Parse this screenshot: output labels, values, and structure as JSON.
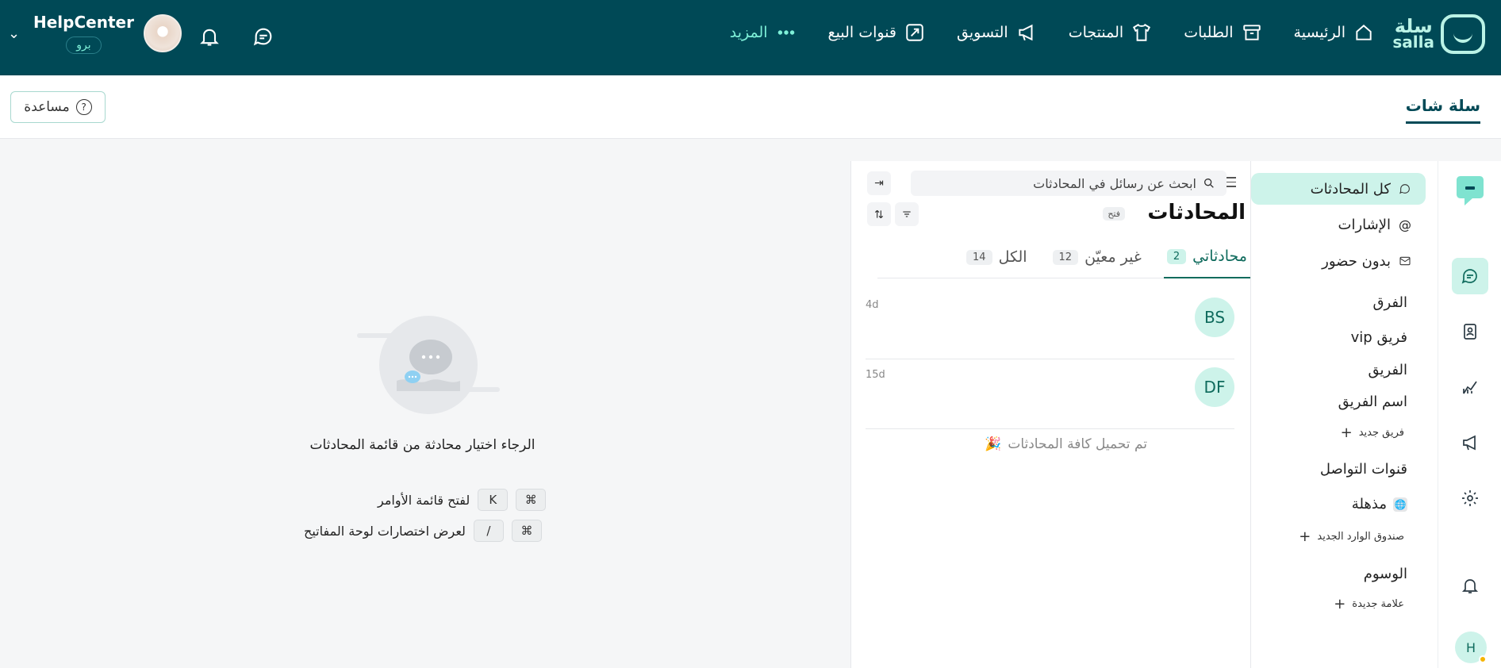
{
  "topnav": {
    "logo_text_ar": "سلة",
    "logo_text_en": "salla",
    "items": [
      {
        "label": "الرئيسية",
        "icon": "home-icon"
      },
      {
        "label": "الطلبات",
        "icon": "box-icon"
      },
      {
        "label": "المنتجات",
        "icon": "shirt-icon"
      },
      {
        "label": "التسويق",
        "icon": "megaphone-icon"
      },
      {
        "label": "قنوات البيع",
        "icon": "sales-channel-icon"
      },
      {
        "label": "المزيد",
        "icon": "more-dots-icon"
      }
    ],
    "account_name": "HelpCenter",
    "account_plan": "برو"
  },
  "pagehead": {
    "title": "سلة شات",
    "help_label": "مساعدة"
  },
  "sidebar": {
    "all_conversations": "كل المحادثات",
    "mentions": "الإشارات",
    "unattended": "بدون حضور",
    "teams_heading": "الفرق",
    "team_vip": "فريق vip",
    "team_generic": "الفريق",
    "team_name": "اسم الفريق",
    "new_team": "فريق جديد",
    "channels_heading": "قنوات التواصل",
    "channel_1": "مذهلة",
    "new_inbox": "صندوق الوارد الجديد",
    "labels_heading": "الوسوم",
    "new_label": "علامة جديدة"
  },
  "rail": {
    "user_initial": "H"
  },
  "conversations": {
    "search_placeholder": "ابحث عن رسائل في المحادثات",
    "title": "المحادثات",
    "status": "فتح",
    "tabs": [
      {
        "label": "محادثاتي",
        "count": "2"
      },
      {
        "label": "غير معيّن",
        "count": "12"
      },
      {
        "label": "الكل",
        "count": "14"
      }
    ],
    "rows": [
      {
        "initials": "BS",
        "time": "4d"
      },
      {
        "initials": "DF",
        "time": "15d"
      }
    ],
    "loaded_message": "تم تحميل كافة المحادثات",
    "loaded_emoji": "🎉"
  },
  "empty_state": {
    "message": "الرجاء اختيار محادثة من قائمة المحادثات",
    "shortcuts": [
      {
        "keys": [
          "⌘",
          "K"
        ],
        "label": "لفتح قائمة الأوامر"
      },
      {
        "keys": [
          "⌘",
          "/"
        ],
        "label": "لعرض اختصارات لوحة المفاتيح"
      }
    ]
  },
  "colors": {
    "topnav_bg": "#004956",
    "accent": "#0f6b5d",
    "accent_light": "#cdf3ea",
    "more_link": "#7ef0d8"
  }
}
